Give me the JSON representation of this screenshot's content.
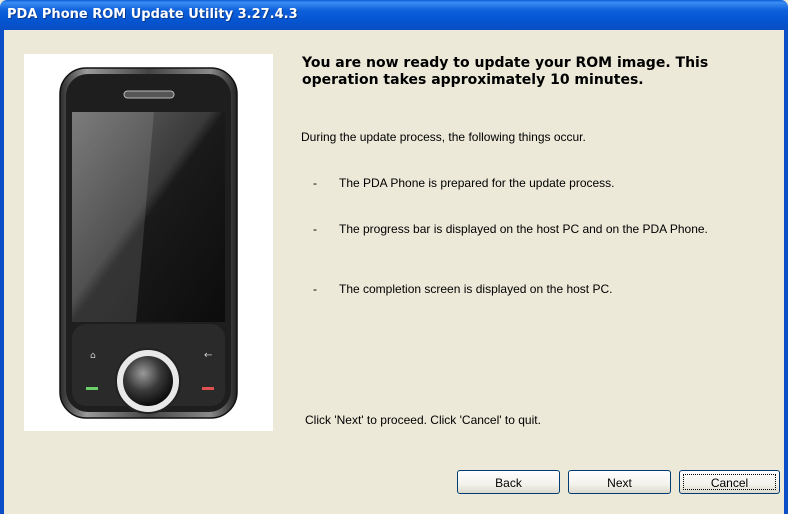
{
  "window": {
    "title": "PDA Phone ROM Update Utility 3.27.4.3"
  },
  "content": {
    "heading": "You are now ready to update your ROM image. This operation takes approximately 10 minutes.",
    "intro": "During the update process, the following things occur.",
    "bullets": [
      {
        "dash": "-",
        "text": "The PDA Phone is prepared for the update process."
      },
      {
        "dash": "-",
        "text": "The progress bar is displayed on the host PC and on the PDA Phone."
      },
      {
        "dash": "-",
        "text": "The completion screen is displayed on the host PC."
      }
    ],
    "footer": "Click 'Next' to proceed. Click 'Cancel' to quit."
  },
  "buttons": {
    "back": "Back",
    "next": "Next",
    "cancel": "Cancel"
  }
}
